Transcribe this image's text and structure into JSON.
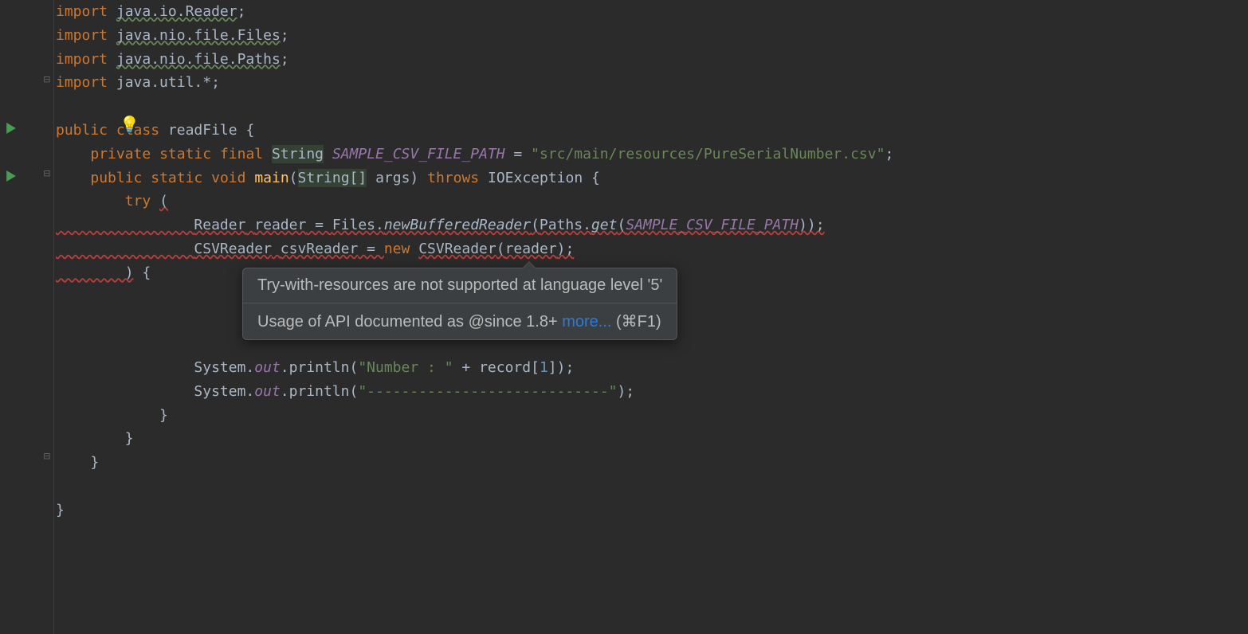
{
  "code": {
    "import1": "import java.io.Reader;",
    "import2": "import java.nio.file.Files;",
    "import3": "import java.nio.file.Paths;",
    "import4": "import java.util.*;",
    "kw_public": "public",
    "kw_class": "class",
    "kw_private": "private",
    "kw_static": "static",
    "kw_final": "final",
    "kw_void": "void",
    "kw_throws": "throws",
    "kw_try": "try",
    "kw_new": "new",
    "className": "readFile",
    "type_String": "String",
    "type_StringArr": "String[]",
    "type_Reader": "Reader",
    "type_CSVReader": "CSVReader",
    "type_IOException": "IOException",
    "field_sample": "SAMPLE_CSV_FILE_PATH",
    "str_path": "\"src/main/resources/PureSerialNumber.csv\"",
    "method_main": "main",
    "param_args": "args",
    "var_reader": "reader",
    "var_csvReader": "csvReader",
    "cls_Files": "Files",
    "m_newBufferedReader": "newBufferedReader",
    "cls_Paths": "Paths",
    "m_get": "get",
    "sys": "System",
    "out": "out",
    "println": "println",
    "str_number": "\"Number : \"",
    "str_dash": "\"----------------------------\"",
    "var_record": "record",
    "idx1": "1"
  },
  "tooltip": {
    "line1": "Try-with-resources are not supported at language level '5'",
    "line2_a": "Usage of API documented as @since 1.8+ ",
    "line2_link": "more...",
    "line2_b": " (⌘F1)"
  }
}
